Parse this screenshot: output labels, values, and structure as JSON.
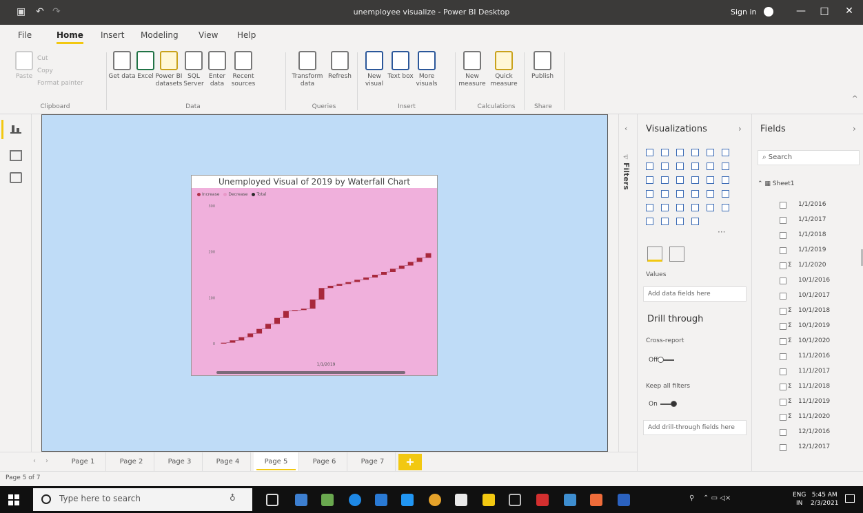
{
  "window": {
    "title": "unemployee visualize - Power BI Desktop",
    "sign_in": "Sign in",
    "minimize": "—",
    "maximize": "□",
    "close": "✕"
  },
  "menu": {
    "tabs": [
      "File",
      "Home",
      "Insert",
      "Modeling",
      "View",
      "Help"
    ],
    "active": "Home"
  },
  "ribbon": {
    "clipboard": {
      "label": "Clipboard",
      "paste": "Paste",
      "cut": "Cut",
      "copy": "Copy",
      "format_painter": "Format painter"
    },
    "data": {
      "label": "Data",
      "buttons": [
        "Get data",
        "Excel",
        "Power BI datasets",
        "SQL Server",
        "Enter data",
        "Recent sources"
      ]
    },
    "queries": {
      "label": "Queries",
      "buttons": [
        "Transform data",
        "Refresh"
      ]
    },
    "insert": {
      "label": "Insert",
      "buttons": [
        "New visual",
        "Text box",
        "More visuals"
      ]
    },
    "calculations": {
      "label": "Calculations",
      "buttons": [
        "New measure",
        "Quick measure"
      ]
    },
    "share": {
      "label": "Share",
      "buttons": [
        "Publish"
      ]
    }
  },
  "visual": {
    "title": "Unemployed Visual of 2019 by Waterfall Chart",
    "legend": [
      "Increase",
      "Decrease",
      "Total"
    ],
    "legend_colors": [
      "#b0304a",
      "#e898c8",
      "#2a2a2a"
    ],
    "bar_color": "#a8283c",
    "x_axis_label": "1/1/2019"
  },
  "chart_data": {
    "type": "bar",
    "subtype": "waterfall",
    "title": "Unemployed Visual of 2019 by Waterfall Chart",
    "xlabel": "1/1/2019",
    "ylabel": "",
    "ylim": [
      0,
      300
    ],
    "y_ticks": [
      0,
      100,
      200,
      300
    ],
    "series": [
      {
        "name": "Increase",
        "values": [
          2,
          5,
          7,
          8,
          10,
          11,
          13,
          15,
          2,
          3,
          20,
          25,
          5,
          4,
          4,
          5,
          5,
          6,
          6,
          7,
          7,
          8,
          9,
          10
        ]
      }
    ]
  },
  "filters": {
    "label": "Filters"
  },
  "visualizations": {
    "title": "Visualizations",
    "values_label": "Values",
    "values_placeholder": "Add data fields here",
    "drill_through": "Drill through",
    "cross_report": "Cross-report",
    "cross_report_state": "Off",
    "keep_all_filters": "Keep all filters",
    "keep_all_filters_state": "On",
    "drill_placeholder": "Add drill-through fields here",
    "more": "···"
  },
  "fields": {
    "title": "Fields",
    "search_placeholder": "Search",
    "table": "Sheet1",
    "items": [
      {
        "name": "1/1/2016",
        "sigma": ""
      },
      {
        "name": "1/1/2017",
        "sigma": ""
      },
      {
        "name": "1/1/2018",
        "sigma": ""
      },
      {
        "name": "1/1/2019",
        "sigma": ""
      },
      {
        "name": "1/1/2020",
        "sigma": "Σ"
      },
      {
        "name": "10/1/2016",
        "sigma": ""
      },
      {
        "name": "10/1/2017",
        "sigma": ""
      },
      {
        "name": "10/1/2018",
        "sigma": "Σ"
      },
      {
        "name": "10/1/2019",
        "sigma": "Σ"
      },
      {
        "name": "10/1/2020",
        "sigma": "Σ"
      },
      {
        "name": "11/1/2016",
        "sigma": ""
      },
      {
        "name": "11/1/2017",
        "sigma": ""
      },
      {
        "name": "11/1/2018",
        "sigma": "Σ"
      },
      {
        "name": "11/1/2019",
        "sigma": "Σ"
      },
      {
        "name": "11/1/2020",
        "sigma": "Σ"
      },
      {
        "name": "12/1/2016",
        "sigma": ""
      },
      {
        "name": "12/1/2017",
        "sigma": ""
      }
    ]
  },
  "pages": {
    "tabs": [
      "Page 1",
      "Page 2",
      "Page 3",
      "Page 4",
      "Page 5",
      "Page 6",
      "Page 7"
    ],
    "active": "Page 5",
    "add": "+"
  },
  "status": {
    "text": "Page 5 of 7"
  },
  "taskbar": {
    "search_placeholder": "Type here to search",
    "lang_1": "ENG",
    "lang_2": "IN",
    "time": "5:45 AM",
    "date": "2/3/2021"
  }
}
